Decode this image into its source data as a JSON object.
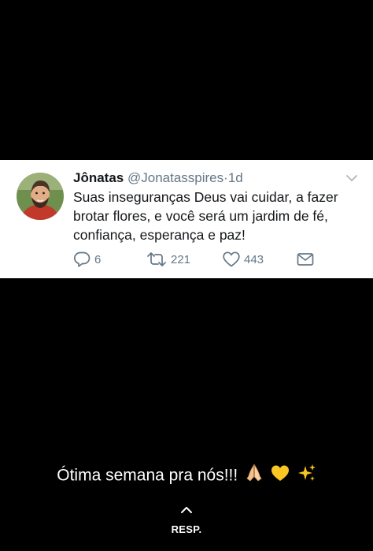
{
  "tweet": {
    "author_name": "Jônatas",
    "handle": "@Jonatasspires",
    "separator": "·",
    "time": "1d",
    "text": "Suas inseguranças Deus vai cuidar, a fazer brotar flores, e você será um jardim de fé, confiança, esperança e paz!",
    "reply_count": "6",
    "retweet_count": "221",
    "like_count": "443",
    "icons": {
      "reply": "reply-icon",
      "retweet": "retweet-icon",
      "like": "heart-icon",
      "dm": "envelope-icon",
      "menu": "chevron-down-icon"
    }
  },
  "post": {
    "caption": "Ótima semana pra nós!!!",
    "caption_emojis": [
      "praying-hands-emoji",
      "yellow-heart-emoji",
      "sparkles-emoji"
    ]
  },
  "reply_control": {
    "label": "RESP.",
    "icon": "chevron-up-icon"
  },
  "colors": {
    "background": "#000000",
    "card": "#ffffff",
    "text_primary": "#14171a",
    "text_secondary": "#657786"
  }
}
